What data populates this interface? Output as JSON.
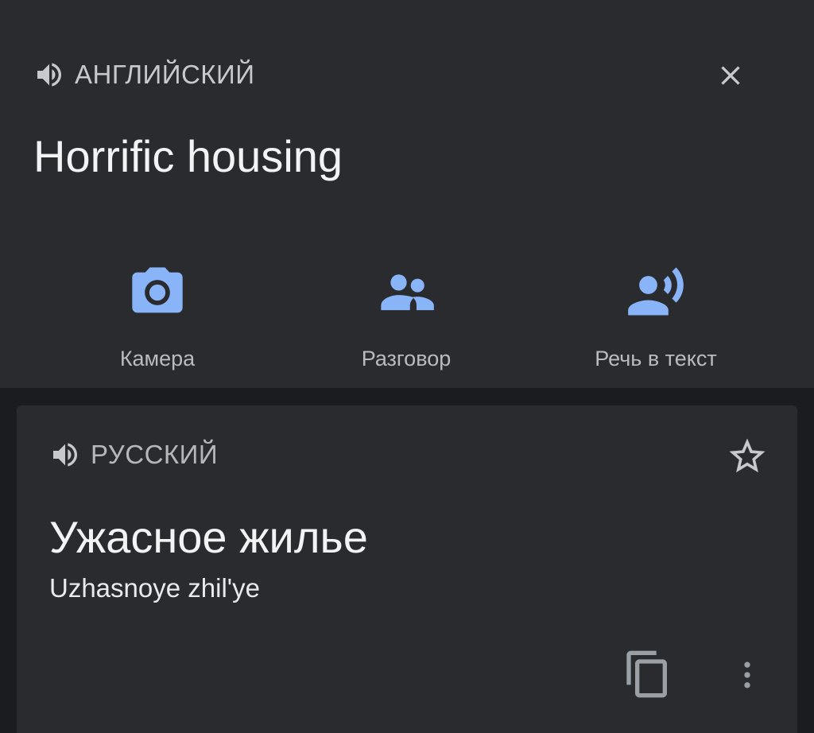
{
  "source": {
    "language_label": "АНГЛИЙСКИЙ",
    "text": "Horrific housing",
    "speaker_icon": "volume-up-icon",
    "close_icon": "close-icon"
  },
  "tools": [
    {
      "label": "Камера",
      "icon": "camera-icon"
    },
    {
      "label": "Разговор",
      "icon": "people-icon"
    },
    {
      "label": "Речь в текст",
      "icon": "record-voice-icon"
    }
  ],
  "result": {
    "language_label": "РУССКИЙ",
    "translation": "Ужасное жилье",
    "transliteration": "Uzhasnoye zhil'ye",
    "star_icon": "star-outline-icon",
    "copy_icon": "copy-icon",
    "more_icon": "more-vert-icon"
  },
  "colors": {
    "accent": "#8ab4f8",
    "panel": "#2a2b2f",
    "background": "#1b1c1f",
    "icon_gray": "#9aa0a6"
  }
}
